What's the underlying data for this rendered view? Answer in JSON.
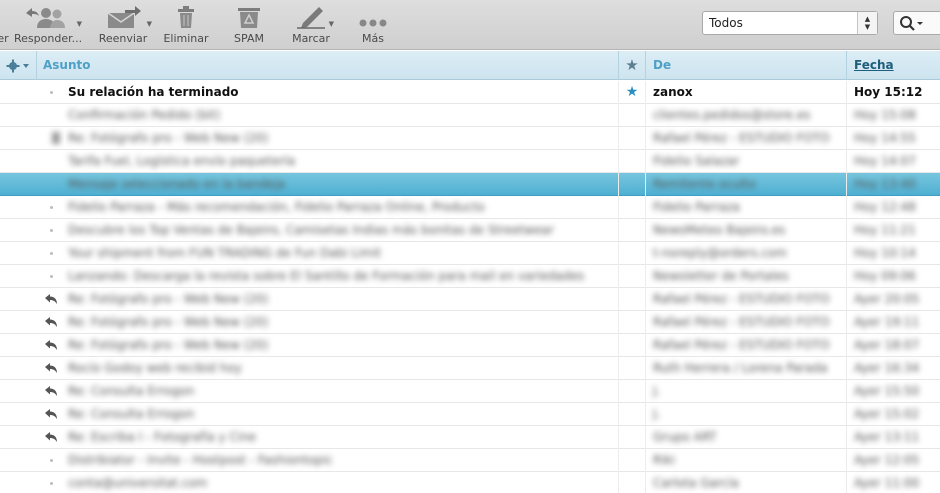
{
  "toolbar": {
    "cut_label": "er",
    "reply_label": "Responder...",
    "forward_label": "Reenviar",
    "delete_label": "Eliminar",
    "spam_label": "SPAM",
    "mark_label": "Marcar",
    "more_label": "Más",
    "filter_value": "Todos"
  },
  "columns": {
    "subject": "Asunto",
    "from": "De",
    "date": "Fecha"
  },
  "messages": [
    {
      "icon": "dot",
      "subject": "Su relación ha terminado",
      "starred": true,
      "from": "zanox",
      "date": "Hoy 15:12",
      "bold": true,
      "blurred": false,
      "selected": false
    },
    {
      "icon": "none",
      "subject": "Confirmación Pedido (bit)",
      "starred": false,
      "from": "clientes.pedidos@store.es",
      "date": "Hoy 15:08",
      "bold": false,
      "blurred": true,
      "selected": false
    },
    {
      "icon": "attach",
      "subject": "Re: Fotógrafo pro - Web New (20)",
      "starred": false,
      "from": "Rafael Pérez - ESTUDIO FOTO",
      "date": "Hoy 14:55",
      "bold": false,
      "blurred": true,
      "selected": false
    },
    {
      "icon": "none",
      "subject": "Tarifa Fuel, Logística envío paquetería",
      "starred": false,
      "from": "Fidelio Salazar",
      "date": "Hoy 14:07",
      "bold": false,
      "blurred": true,
      "selected": false
    },
    {
      "icon": "none",
      "subject": "Mensaje seleccionado en la bandeja",
      "starred": false,
      "from": "Remitente oculto",
      "date": "Hoy 13:40",
      "bold": false,
      "blurred": true,
      "selected": true
    },
    {
      "icon": "dot",
      "subject": "Fidelio Parraza - Más recomendación, Fidelio Parraza Online, Producto",
      "starred": false,
      "from": "Fidelio Parraza",
      "date": "Hoy 12:48",
      "bold": false,
      "blurred": true,
      "selected": false
    },
    {
      "icon": "dot",
      "subject": "Descubre los Top Ventas de Bajeiro, Camisetas Indias más bonitas de Streetwear",
      "starred": false,
      "from": "NewsMeteo Bajeiro.es",
      "date": "Hoy 11:21",
      "bold": false,
      "blurred": true,
      "selected": false
    },
    {
      "icon": "dot",
      "subject": "Your shipment from FUN TRADING de Fun Dabi Limit",
      "starred": false,
      "from": "t-noreply@orders.com",
      "date": "Hoy 10:14",
      "bold": false,
      "blurred": true,
      "selected": false
    },
    {
      "icon": "dot",
      "subject": "Lanzando: Descarga la revista sobre El Santillo de Formación para mail en variedades",
      "starred": false,
      "from": "Newsletter de Portales",
      "date": "Hoy 09:06",
      "bold": false,
      "blurred": true,
      "selected": false
    },
    {
      "icon": "reply",
      "subject": "Re: Fotógrafo pro - Web New (20)",
      "starred": false,
      "from": "Rafael Pérez - ESTUDIO FOTO",
      "date": "Ayer 20:05",
      "bold": false,
      "blurred": true,
      "selected": false
    },
    {
      "icon": "reply",
      "subject": "Re: Fotógrafo pro - Web New (20)",
      "starred": false,
      "from": "Rafael Pérez - ESTUDIO FOTO",
      "date": "Ayer 19:11",
      "bold": false,
      "blurred": true,
      "selected": false
    },
    {
      "icon": "reply",
      "subject": "Re: Fotógrafo pro - Web New (20)",
      "starred": false,
      "from": "Rafael Pérez - ESTUDIO FOTO",
      "date": "Ayer 18:07",
      "bold": false,
      "blurred": true,
      "selected": false
    },
    {
      "icon": "reply",
      "subject": "Rocío Godoy web recibid hoy",
      "starred": false,
      "from": "Ruth Herrera / Lorena Parada",
      "date": "Ayer 16:34",
      "bold": false,
      "blurred": true,
      "selected": false
    },
    {
      "icon": "reply",
      "subject": "Re: Consulta Errogon",
      "starred": false,
      "from": "J.",
      "date": "Ayer 15:50",
      "bold": false,
      "blurred": true,
      "selected": false
    },
    {
      "icon": "reply",
      "subject": "Re: Consulta Errogon",
      "starred": false,
      "from": "J.",
      "date": "Ayer 15:02",
      "bold": false,
      "blurred": true,
      "selected": false
    },
    {
      "icon": "reply",
      "subject": "Re: Escriba I - Fotografía y Cine",
      "starred": false,
      "from": "Grupo ART",
      "date": "Ayer 13:11",
      "bold": false,
      "blurred": true,
      "selected": false
    },
    {
      "icon": "dot",
      "subject": "Distribiator - Invite - Hostpost - Fashiontopic",
      "starred": false,
      "from": "Riki",
      "date": "Ayer 12:05",
      "bold": false,
      "blurred": true,
      "selected": false
    },
    {
      "icon": "dot",
      "subject": "conta@universitat.com",
      "starred": false,
      "from": "Carlota García",
      "date": "Ayer 11:00",
      "bold": false,
      "blurred": true,
      "selected": false
    }
  ]
}
